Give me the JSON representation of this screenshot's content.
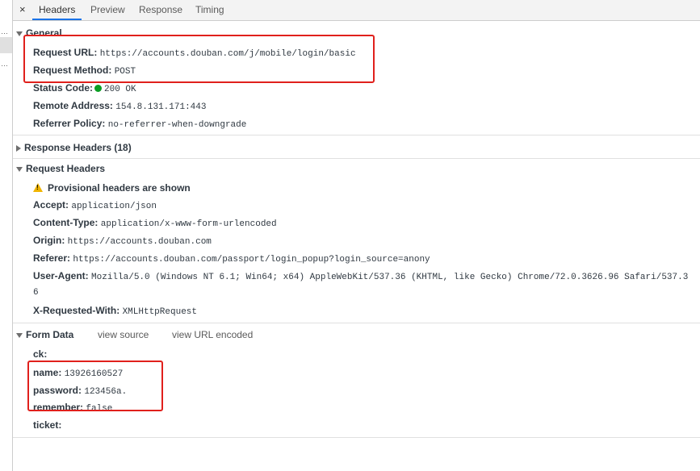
{
  "tabs": {
    "close_glyph": "×",
    "items": [
      "Headers",
      "Preview",
      "Response",
      "Timing"
    ],
    "active": "Headers"
  },
  "general": {
    "title": "General",
    "request_url_label": "Request URL:",
    "request_url": "https://accounts.douban.com/j/mobile/login/basic",
    "request_method_label": "Request Method:",
    "request_method": "POST",
    "status_code_label": "Status Code:",
    "status_code": "200 OK",
    "remote_address_label": "Remote Address:",
    "remote_address": "154.8.131.171:443",
    "referrer_policy_label": "Referrer Policy:",
    "referrer_policy": "no-referrer-when-downgrade"
  },
  "response_headers": {
    "title": "Response Headers (18)"
  },
  "request_headers": {
    "title": "Request Headers",
    "warning": "Provisional headers are shown",
    "accept_label": "Accept:",
    "accept": "application/json",
    "content_type_label": "Content-Type:",
    "content_type": "application/x-www-form-urlencoded",
    "origin_label": "Origin:",
    "origin": "https://accounts.douban.com",
    "referer_label": "Referer:",
    "referer": "https://accounts.douban.com/passport/login_popup?login_source=anony",
    "user_agent_label": "User-Agent:",
    "user_agent_line1": "Mozilla/5.0 (Windows NT 6.1; Win64; x64) AppleWebKit/537.36 (KHTML, like Gecko) Chrome/72.0.3626.96 Safari/537.3",
    "user_agent_line2": "6",
    "x_requested_with_label": "X-Requested-With:",
    "x_requested_with": "XMLHttpRequest"
  },
  "form_data": {
    "title": "Form Data",
    "view_source": "view source",
    "view_url_encoded": "view URL encoded",
    "ck_label": "ck:",
    "name_label": "name:",
    "name": "13926160527",
    "password_label": "password:",
    "password": "123456a.",
    "remember_label": "remember:",
    "remember": "false",
    "ticket_label": "ticket:"
  },
  "colors": {
    "highlight": "#e0201c",
    "status_ok": "#0a9e23",
    "warning": "#f0b400",
    "tab_accent": "#1a73e8"
  }
}
